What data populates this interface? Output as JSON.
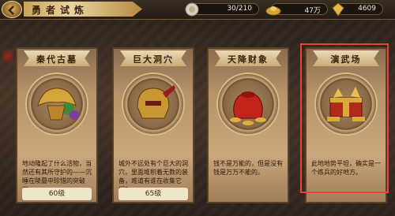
{
  "header": {
    "title": "勇者试炼",
    "resources": [
      {
        "icon": "silver-coin-icon",
        "value": "30/210"
      },
      {
        "icon": "gold-ingot-icon",
        "value": "47万"
      },
      {
        "icon": "gem-icon",
        "value": "4609"
      }
    ]
  },
  "cards": [
    {
      "name": "秦代古墓",
      "desc": "地动隆起了什么活物，当然还有其所守护的——沉睡在陵墓中珍惜的突破石。",
      "level": "60级",
      "icon": "feathered-helmet-icon"
    },
    {
      "name": "巨大洞穴",
      "desc": "城外不远处有个巨大的洞穴，里面堆积着无数的装备，难道有谁在收集它们？",
      "level": "65级",
      "icon": "armor-helmet-icon"
    },
    {
      "name": "天降财象",
      "desc": "钱不是万能的，但是没有钱是万万不能的。",
      "level": "",
      "icon": "money-bag-icon"
    },
    {
      "name": "演武场",
      "desc": "此地地势平坦，确实是一个练兵的好地方。",
      "level": "",
      "icon": "treasure-chest-icon"
    }
  ],
  "colors": {
    "highlight": "#e8433a",
    "accent": "#c9a35a"
  }
}
